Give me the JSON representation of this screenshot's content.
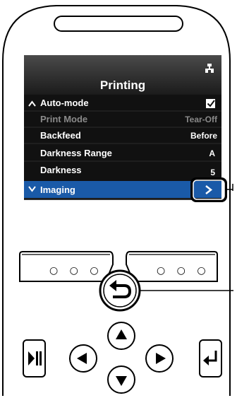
{
  "screen": {
    "title": "Printing",
    "network_icon": "network-icon",
    "rows": [
      {
        "label": "Auto-mode",
        "value": "",
        "state": "normal",
        "prefix_icon": "caret-up-icon",
        "control": "checkbox-checked"
      },
      {
        "label": "Print Mode",
        "value": "Tear-Off",
        "state": "disabled"
      },
      {
        "label": "Backfeed",
        "value": "Before",
        "state": "normal"
      },
      {
        "label": "Darkness Range",
        "value": "A",
        "state": "normal"
      },
      {
        "label": "Darkness",
        "value": "5",
        "state": "normal"
      },
      {
        "label": "Imaging",
        "value": "",
        "state": "selected",
        "prefix_icon": "caret-down-icon",
        "control": "chevron-right-icon"
      }
    ]
  },
  "softkeys": {
    "left_label": "○ ○ ○",
    "right_label": "○ ○ ○"
  },
  "buttons": {
    "back": "back-icon",
    "up": "arrow-up-icon",
    "down": "arrow-down-icon",
    "left": "arrow-left-icon",
    "right": "arrow-right-icon",
    "play_pause": "play-pause-icon",
    "enter": "enter-icon"
  },
  "colors": {
    "screen_bg": "#111111",
    "title_gradient_top": "#3a3a3a",
    "selected_row": "#1a5aa8",
    "row_separator": "#2a2a2a",
    "highlight_box": "#000000"
  }
}
